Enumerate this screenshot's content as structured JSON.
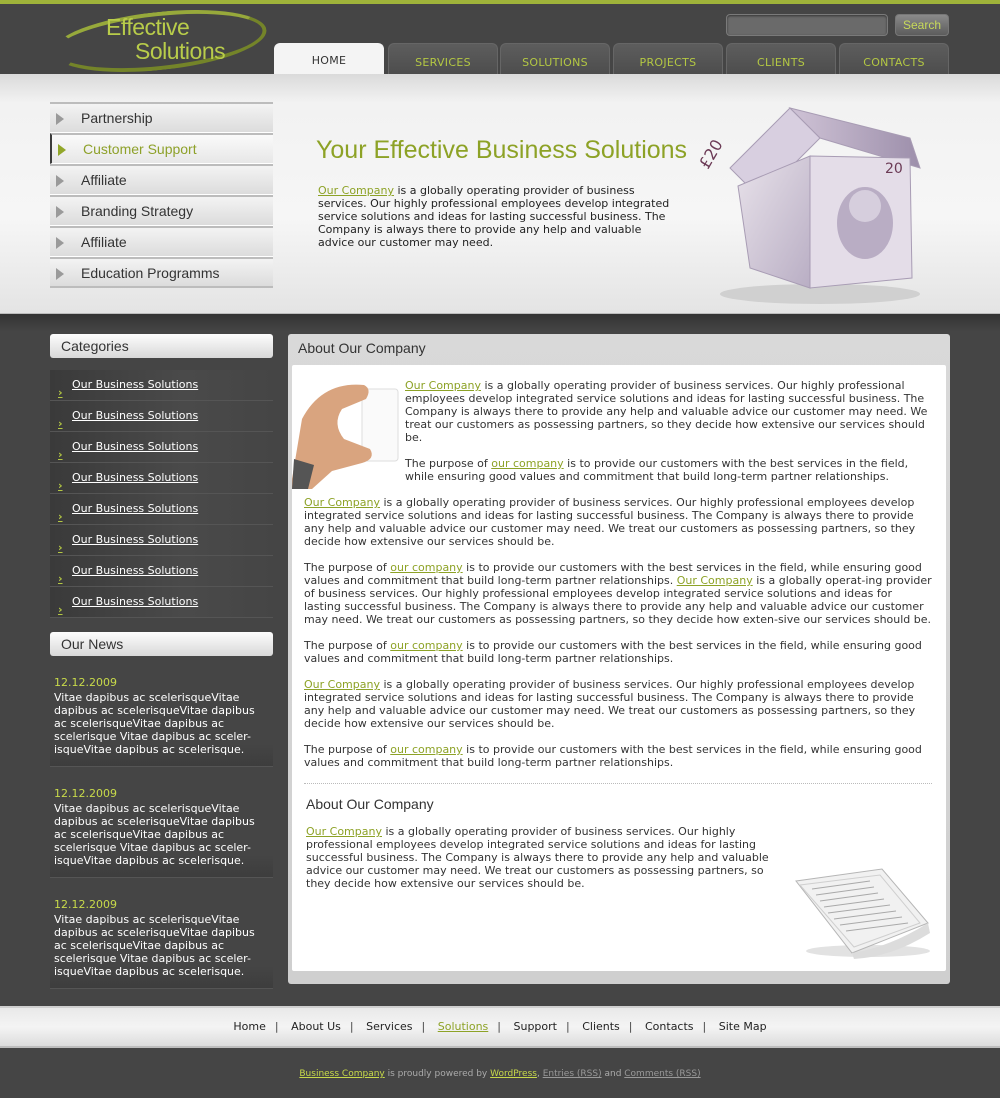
{
  "logo": {
    "line1": "Effective",
    "line2": "Solutions"
  },
  "search": {
    "placeholder": "",
    "button": "Search"
  },
  "nav": [
    {
      "label": "HOME",
      "active": true
    },
    {
      "label": "SERVICES"
    },
    {
      "label": "SOLUTIONS"
    },
    {
      "label": "PROJECTS"
    },
    {
      "label": "CLIENTS"
    },
    {
      "label": "CONTACTS"
    }
  ],
  "submenu": [
    {
      "label": "Partnership"
    },
    {
      "label": "Customer Support",
      "active": true
    },
    {
      "label": "Affiliate"
    },
    {
      "label": "Branding Strategy"
    },
    {
      "label": "Affiliate"
    },
    {
      "label": "Education Programms"
    }
  ],
  "banner": {
    "title": "Your Effective Business Solutions",
    "link": "Our Company",
    "text": " is a globally operating provider of business services. Our highly professional employees develop integrated service solutions and ideas for lasting successful business. The Company is always there to provide any help and valuable advice our customer may need."
  },
  "sidebar": {
    "categories_title": "Categories",
    "categories": [
      "Our Business Solutions",
      "Our Business Solutions",
      "Our Business Solutions",
      "Our Business Solutions",
      "Our Business Solutions",
      "Our Business Solutions",
      "Our Business Solutions",
      "Our Business Solutions"
    ],
    "news_title": "Our News",
    "news": [
      {
        "date": "12.12.2009",
        "text": "Vitae dapibus ac scelerisqueVitae dapibus ac scelerisqueVitae dapibus ac scelerisqueVitae dapibus ac scelerisque Vitae dapibus ac sceler-isqueVitae dapibus ac scelerisque."
      },
      {
        "date": "12.12.2009",
        "text": "Vitae dapibus ac scelerisqueVitae dapibus ac scelerisqueVitae dapibus ac scelerisqueVitae dapibus ac scelerisque Vitae dapibus ac sceler-isqueVitae dapibus ac scelerisque."
      },
      {
        "date": "12.12.2009",
        "text": "Vitae dapibus ac scelerisqueVitae dapibus ac scelerisqueVitae dapibus ac scelerisqueVitae dapibus ac scelerisque Vitae dapibus ac sceler-isqueVitae dapibus ac scelerisque."
      }
    ]
  },
  "content": {
    "title": "About Our Company",
    "link": "Our Company",
    "link_lower": "our company",
    "intro1": " is a globally operating provider of business services. Our highly professional employees develop integrated service solutions and ideas for lasting successful business. The Company is always there to provide any help and valuable advice our customer may need. We treat our customers as possessing partners, so they decide how extensive our services should be.",
    "purpose_pre": "The purpose of ",
    "purpose_post": " is to provide our customers with the best services in the field, while ensuring good values and commitment that build long-term partner relationships.",
    "para_main": " is a globally operating provider of business services. Our highly professional employees develop integrated service solutions and ideas for lasting successful business. The Company is always there to provide any help and valuable advice our customer may need. We treat our customers as possessing partners, so they decide how extensive our services should be.",
    "purpose_mid": " is to provide our customers with the best services in the field, while ensuring good values and commitment that build long-term partner relationships. ",
    "para_tail": " is a globally operat-ing provider of business services. Our highly professional employees develop integrated service solutions and ideas for lasting successful business. The Company is always there to provide any help and valuable advice our customer may need. We treat our customers as possessing partners, so they decide how exten-sive our services should be.",
    "sub_title": "About Our Company",
    "sub_text": " is a globally operating provider of business services. Our highly professional employees develop integrated service solutions and ideas for lasting successful business. The Company is always there to provide any help and valuable advice our customer may need. We treat our customers as possessing partners, so they decide how extensive our services should be."
  },
  "footer": {
    "links": [
      {
        "label": "Home"
      },
      {
        "label": "About Us"
      },
      {
        "label": "Services"
      },
      {
        "label": "Solutions",
        "active": true
      },
      {
        "label": "Support"
      },
      {
        "label": "Clients"
      },
      {
        "label": "Contacts"
      },
      {
        "label": "Site Map"
      }
    ],
    "separator": "|",
    "copy_link": "Business Company",
    "copy_mid": " is proudly powered by ",
    "wp": "WordPress",
    "comma": ", ",
    "entries": "Entries (RSS)",
    "and": " and ",
    "comments": "Comments (RSS)"
  },
  "colors": {
    "accent": "#8da226",
    "accent_light": "#c8da4a",
    "bg_dark": "#454545",
    "top_stripe": "#9fb33a"
  },
  "icons": {
    "submenu_arrow": "triangle-right",
    "category_chevron": "›"
  }
}
